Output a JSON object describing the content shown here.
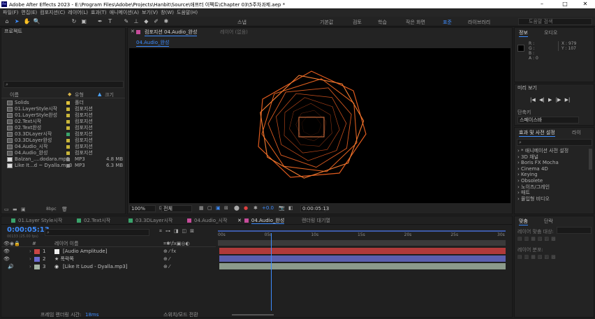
{
  "window": {
    "app_logo": "Ae",
    "title": "Adobe After Effects 2023 - E:\\Program Files\\Adobe\\Projects\\Hanbit\\Source\\애프터 이펙트\\Chapter 03\\5주차과제.aep *",
    "minimize": "–",
    "maximize": "□",
    "close": "✕"
  },
  "menu": [
    "파일(F)",
    "편집(E)",
    "컴포지션(C)",
    "레이어(L)",
    "효과(T)",
    "애니메이션(A)",
    "보기(V)",
    "창(W)",
    "도움말(H)"
  ],
  "tools": {
    "home": "⌂",
    "select": "➤",
    "hand": "✋",
    "zoom": "🔍",
    "rotate": "↻",
    "camera": "▣",
    "pen": "✒",
    "type": "T",
    "brush": "✎",
    "stamp": "⊥",
    "eraser": "◆",
    "roto": "✐",
    "puppet": "✱"
  },
  "snapping": "스냅",
  "workspaces": [
    "기본값",
    "검토",
    "학습",
    "작은 화면",
    "표준",
    "라이브러리"
  ],
  "active_workspace": "표준",
  "search_help": {
    "placeholder": "도움말 검색"
  },
  "project": {
    "title": "프로젝트",
    "search_icon": "⌕",
    "columns": {
      "name": "이름",
      "type": "유형",
      "size": "크기"
    },
    "items": [
      {
        "name": "Solids",
        "type": "폴더",
        "size": "",
        "color": "#e0c23a"
      },
      {
        "name": "01.LayerStyle시작",
        "type": "컴포지션",
        "size": "",
        "color": "#c9b63a"
      },
      {
        "name": "01.LayerStyle완성",
        "type": "컴포지션",
        "size": "",
        "color": "#c9b63a"
      },
      {
        "name": "02.Text시작",
        "type": "컴포지션",
        "size": "",
        "color": "#c9b63a"
      },
      {
        "name": "02.Text완성",
        "type": "컴포지션",
        "size": "",
        "color": "#c9b63a"
      },
      {
        "name": "03.3DLayer시작",
        "type": "컴포지션",
        "size": "",
        "color": "#c9b63a"
      },
      {
        "name": "03.3DLayer완성",
        "type": "컴포지션",
        "size": "",
        "color": "#c9b63a"
      },
      {
        "name": "04.Audio_시작",
        "type": "컴포지션",
        "size": "",
        "color": "#c9b63a"
      },
      {
        "name": "04.Audio_완성",
        "type": "컴포지션",
        "size": "",
        "color": "#c9b63a"
      },
      {
        "name": "Balzan_....dodara.mp3",
        "type": "MP3",
        "size": "4.8 MB",
        "color": "#8f8f8f"
      },
      {
        "name": "Like It...d ~ Dyalla.mp3",
        "type": "MP3",
        "size": "6.3 MB",
        "color": "#8f8f8f"
      }
    ],
    "bpc": "8bpc"
  },
  "composition": {
    "tab_label": "컴포지션 04.Audio_완성",
    "layer_tab": "레이어 (없음)",
    "flow_tab": "04.Audio_완성",
    "zoom": "100%",
    "resolution": "전체",
    "exposure": "+0.0",
    "timecode": "0:00:05:13"
  },
  "info": {
    "tab": "정보",
    "audio_tab": "오디오",
    "r": "R :",
    "g": "G :",
    "b": "B :",
    "a": "A : 0",
    "x": "X : 979",
    "y": "Y : 107"
  },
  "preview": {
    "tab": "미리 보기",
    "shortcut_label": "단축키",
    "shortcut_value": "스페이스바",
    "controls": [
      "|◀",
      "◀|",
      "▶",
      "|▶",
      "▶|"
    ]
  },
  "effects": {
    "tab": "효과 및 사전 설정",
    "lib_tab": "라이",
    "search_placeholder": "",
    "items": [
      "* 애니메이션 사전 설정",
      "3D 채널",
      "Boris FX Mocha",
      "Cinema 4D",
      "Keying",
      "Obsolete",
      "노이즈/그레인",
      "매트",
      "몰입형 비디오"
    ]
  },
  "align": {
    "tab": "맞춤",
    "para_tab": "단락",
    "align_to": "레이어 맞춤 대상:",
    "distribute": "레이어 분포:"
  },
  "timeline": {
    "tabs": [
      {
        "label": "01.Layer Style시작",
        "color": "#3aa36b"
      },
      {
        "label": "02.Text시작",
        "color": "#3aa36b"
      },
      {
        "label": "03.3DLayer시작",
        "color": "#3aa36b"
      },
      {
        "label": "04.Audio_시작",
        "color": "#c74c9b"
      },
      {
        "label": "04.Audio_완성",
        "color": "#c74c9b"
      }
    ],
    "render_queue": "렌더링 대기열",
    "timecode": "0:00:05:13",
    "fps_info": "00133 (25.00 fps)",
    "col_num": "#",
    "col_name": "레이어 이름",
    "ruler": [
      "00s",
      "05s",
      "10s",
      "15s",
      "20s",
      "25s",
      "30s"
    ],
    "playhead_fraction": 0.184,
    "layers": [
      {
        "num": "1",
        "name": "[Audio Amplitude]",
        "label": "#c94646",
        "bar": "#b03a3a",
        "switch": "fx"
      },
      {
        "num": "2",
        "name": "★ 폭락쪽",
        "label": "#6b6bd1",
        "bar": "#5b5fae",
        "switch": ""
      },
      {
        "num": "3",
        "name": "[Like It Loud - Dyalla.mp3]",
        "label": "#a5b5a5",
        "bar": "#8c9a8c",
        "switch": ""
      }
    ],
    "frame_render": "프레임 렌더링 시간:",
    "frame_render_value": "18ms",
    "toggle": "스위치/모드 전환"
  }
}
